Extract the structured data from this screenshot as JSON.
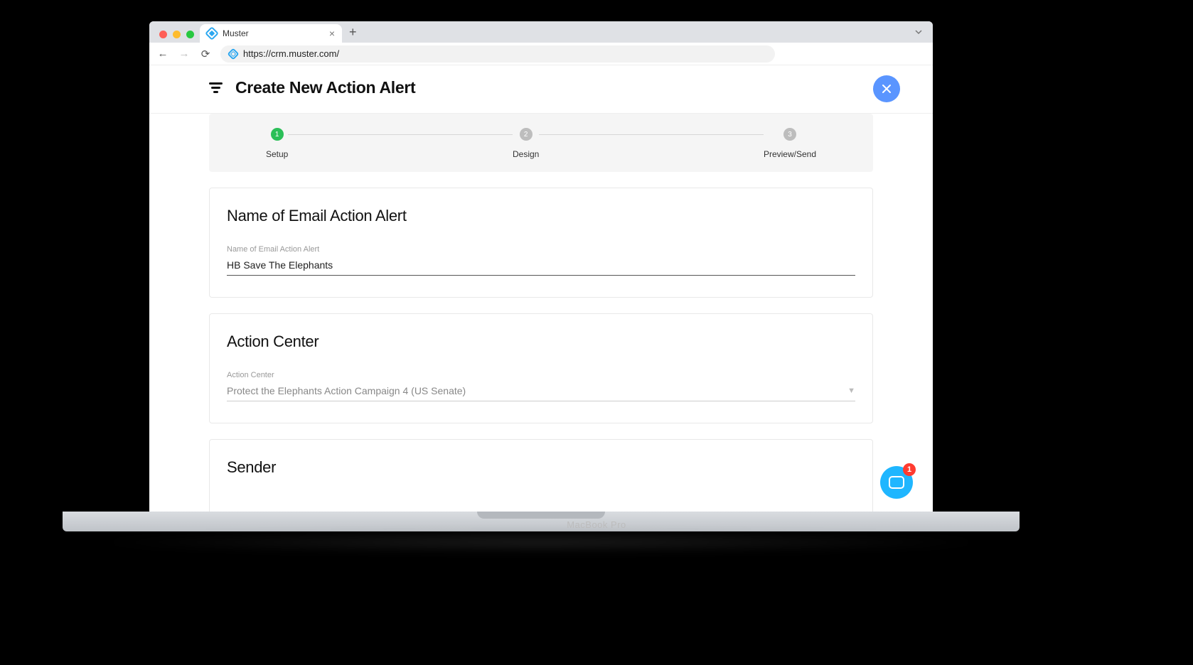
{
  "browser": {
    "tab_title": "Muster",
    "url": "https://crm.muster.com/"
  },
  "laptop_brand": "MacBook Pro",
  "header": {
    "title": "Create New Action Alert"
  },
  "stepper": {
    "steps": [
      {
        "num": "1",
        "label": "Setup",
        "active": true
      },
      {
        "num": "2",
        "label": "Design",
        "active": false
      },
      {
        "num": "3",
        "label": "Preview/Send",
        "active": false
      }
    ]
  },
  "cards": {
    "name": {
      "heading": "Name of Email Action Alert",
      "field_label": "Name of Email Action Alert",
      "field_value": "HB Save The Elephants"
    },
    "action_center": {
      "heading": "Action Center",
      "field_label": "Action Center",
      "select_value": "Protect the Elephants Action Campaign 4 (US Senate)"
    },
    "sender": {
      "heading": "Sender"
    }
  },
  "chat": {
    "badge": "1"
  }
}
